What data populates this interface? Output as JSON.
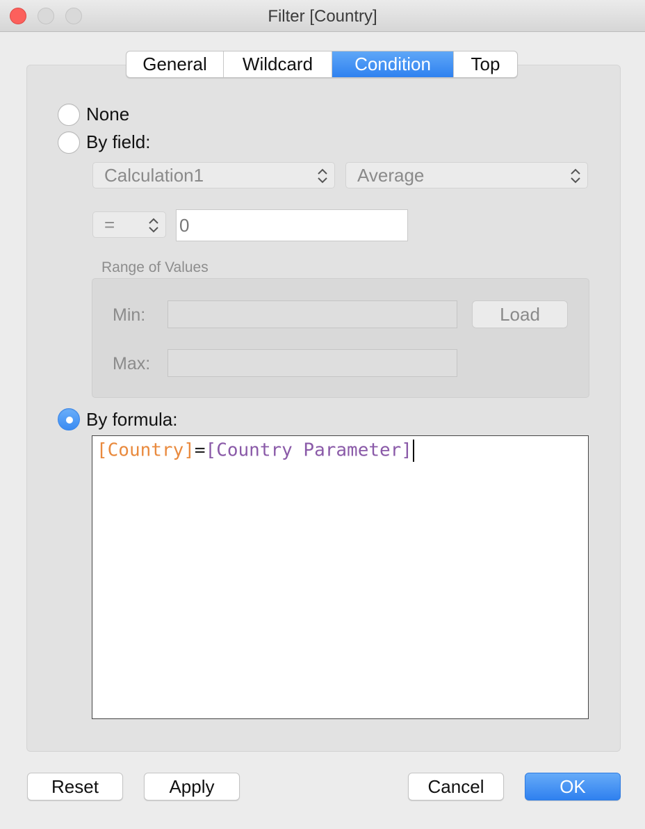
{
  "window": {
    "title": "Filter [Country]"
  },
  "tabs": [
    {
      "label": "General",
      "active": false
    },
    {
      "label": "Wildcard",
      "active": false
    },
    {
      "label": "Condition",
      "active": true
    },
    {
      "label": "Top",
      "active": false
    }
  ],
  "options": {
    "none_label": "None",
    "by_field_label": "By field:",
    "by_formula_label": "By formula:",
    "selected": "by_formula"
  },
  "by_field": {
    "field_value": "Calculation1",
    "aggregation_value": "Average",
    "operator_value": "=",
    "compare_value": "0",
    "range_title": "Range of Values",
    "min_label": "Min:",
    "max_label": "Max:",
    "min_value": "",
    "max_value": "",
    "load_label": "Load"
  },
  "formula": {
    "field": "[Country]",
    "operator": "=",
    "parameter": "[Country Parameter]"
  },
  "footer": {
    "reset_label": "Reset",
    "apply_label": "Apply",
    "cancel_label": "Cancel",
    "ok_label": "OK"
  },
  "colors": {
    "accent": "#3a8bf2",
    "formula_field": "#e98a3e",
    "formula_parameter": "#8a5aa8"
  }
}
